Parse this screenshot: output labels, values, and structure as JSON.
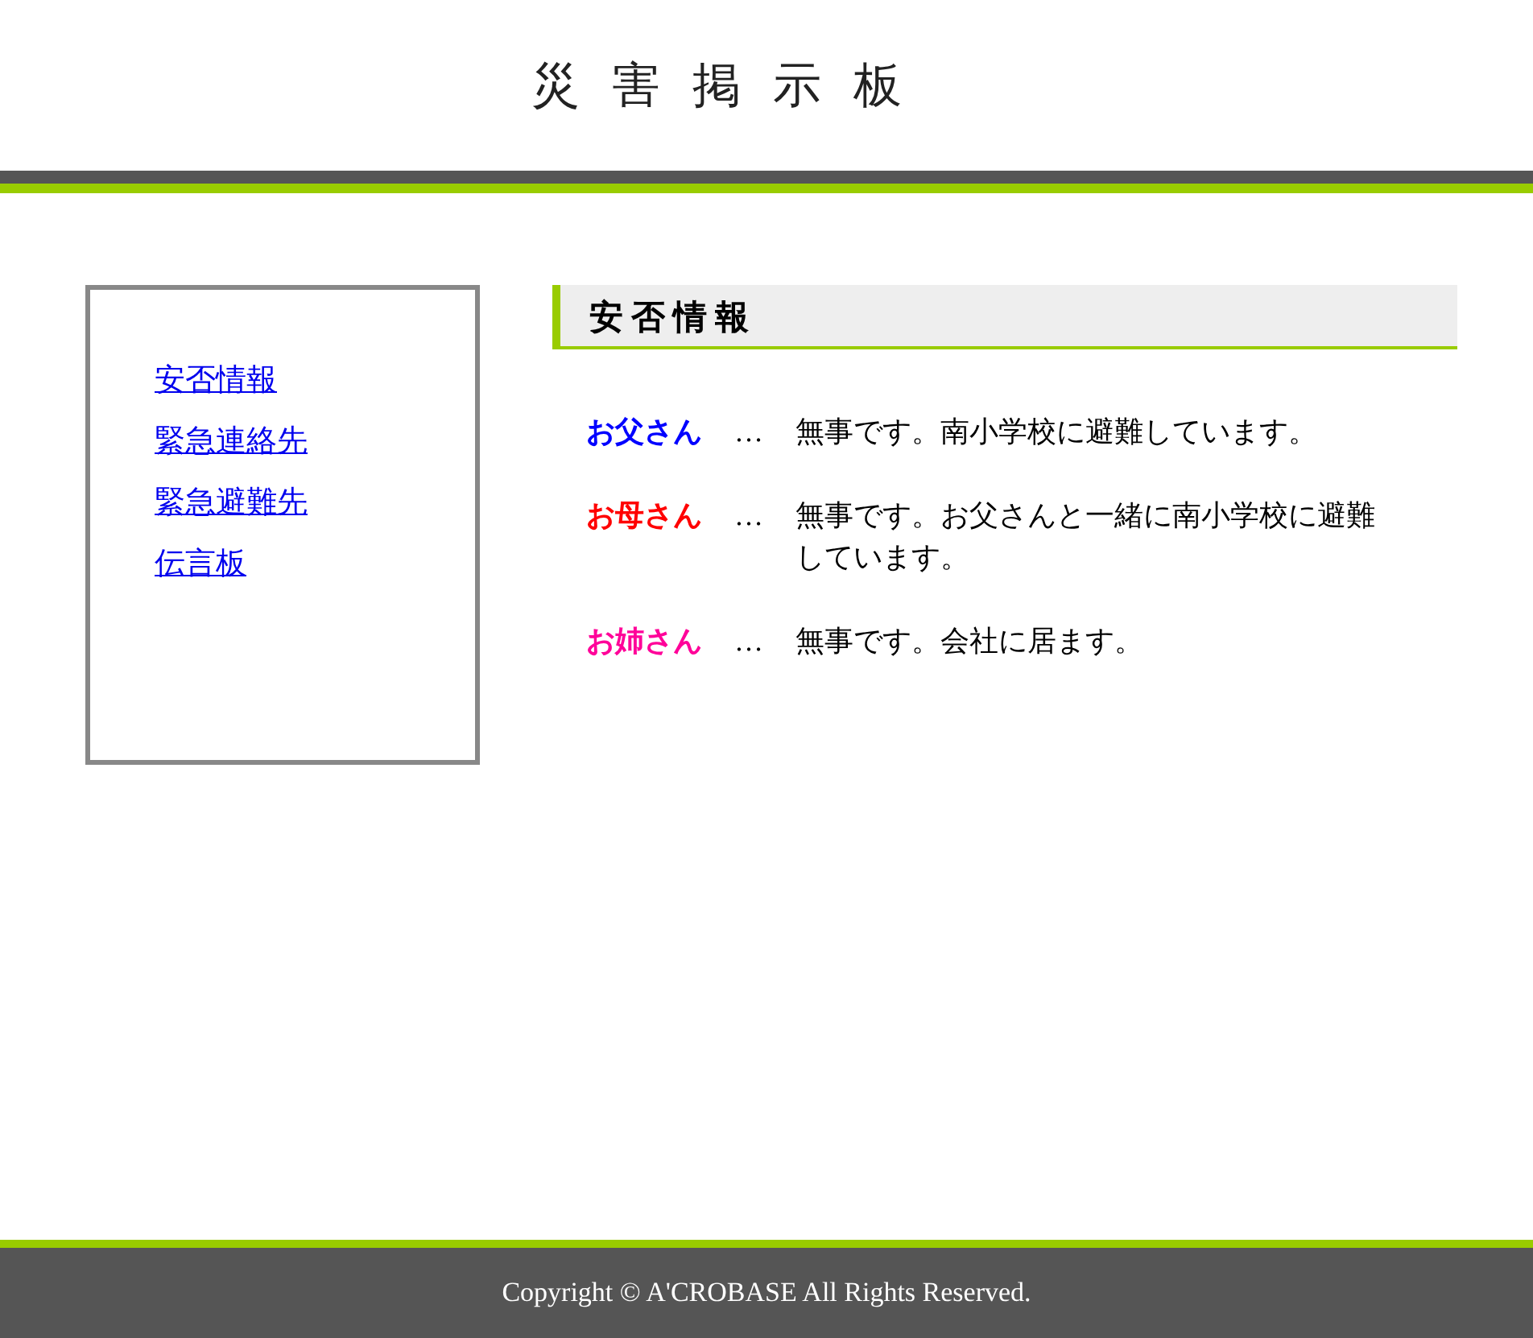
{
  "header": {
    "title": "災害掲示板"
  },
  "sidebar": {
    "items": [
      {
        "label": "安否情報"
      },
      {
        "label": "緊急連絡先"
      },
      {
        "label": "緊急避難先"
      },
      {
        "label": "伝言板"
      }
    ]
  },
  "main": {
    "heading": "安否情報",
    "entries": [
      {
        "name": "お父さん",
        "color": "#0000ff",
        "separator": "…",
        "message": "無事です。南小学校に避難しています。"
      },
      {
        "name": "お母さん",
        "color": "#ff0000",
        "separator": "…",
        "message": "無事です。お父さんと一緒に南小学校に避難しています。"
      },
      {
        "name": "お姉さん",
        "color": "#ff0099",
        "separator": "…",
        "message": "無事です。会社に居ます。"
      }
    ]
  },
  "footer": {
    "copyright": "Copyright © A'CROBASE All Rights Reserved."
  }
}
